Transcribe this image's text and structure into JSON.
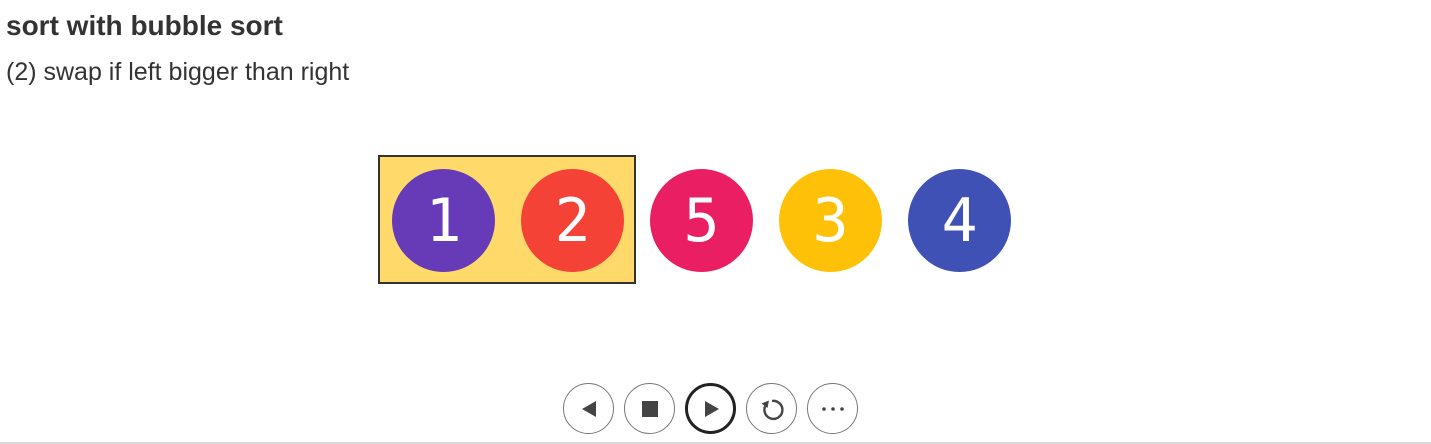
{
  "header": {
    "title": "sort with bubble sort",
    "step_text": "(2) swap if left bigger than right"
  },
  "array": {
    "items": [
      {
        "label": "1",
        "color": "#673ab7",
        "highlighted": true
      },
      {
        "label": "2",
        "color": "#f44336",
        "highlighted": true
      },
      {
        "label": "5",
        "color": "#e91e63",
        "highlighted": false
      },
      {
        "label": "3",
        "color": "#ffc107",
        "highlighted": false
      },
      {
        "label": "4",
        "color": "#3f51b5",
        "highlighted": false
      }
    ],
    "highlight_color": "#ffda6b"
  },
  "controls": {
    "buttons": [
      {
        "name": "previous",
        "icon": "previous-icon",
        "active": false
      },
      {
        "name": "stop",
        "icon": "stop-icon",
        "active": false
      },
      {
        "name": "play",
        "icon": "play-icon",
        "active": true
      },
      {
        "name": "restart",
        "icon": "restart-icon",
        "active": false
      },
      {
        "name": "more",
        "icon": "more-icon",
        "active": false
      }
    ]
  }
}
